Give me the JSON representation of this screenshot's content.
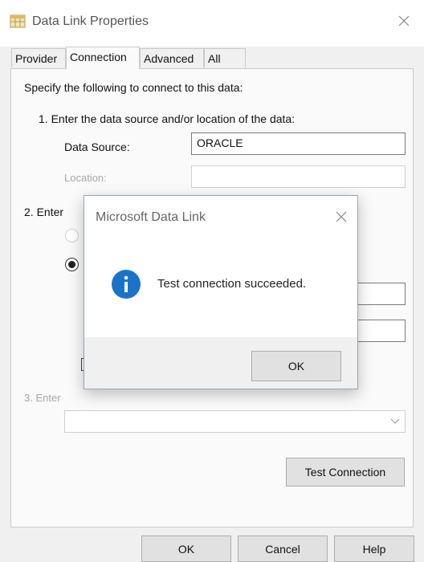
{
  "window": {
    "title": "Data Link Properties",
    "icon": "data-link-icon",
    "close_icon": "close-icon"
  },
  "tabs": [
    {
      "label": "Provider",
      "active": false
    },
    {
      "label": "Connection",
      "active": true
    },
    {
      "label": "Advanced",
      "active": false
    },
    {
      "label": "All",
      "active": false
    }
  ],
  "connection": {
    "intro": "Specify the following to connect to this data:",
    "step1": "1. Enter the data source and/or location of the data:",
    "data_source_label": "Data Source:",
    "data_source_value": "ORACLE",
    "location_label": "Location:",
    "location_value": "",
    "step2": "2. Enter",
    "step3": "3. Enter",
    "initial_catalog_value": "",
    "test_connection_label": "Test Connection"
  },
  "footer": {
    "ok_label": "OK",
    "cancel_label": "Cancel",
    "help_label": "Help"
  },
  "dialog": {
    "title": "Microsoft Data Link",
    "message": "Test connection succeeded.",
    "ok_label": "OK",
    "icon": "info-icon",
    "close_icon": "close-icon"
  },
  "colors": {
    "info_blue": "#1a73c9",
    "window_bg": "#f0f0f0",
    "panel_bg": "#fafafa"
  }
}
